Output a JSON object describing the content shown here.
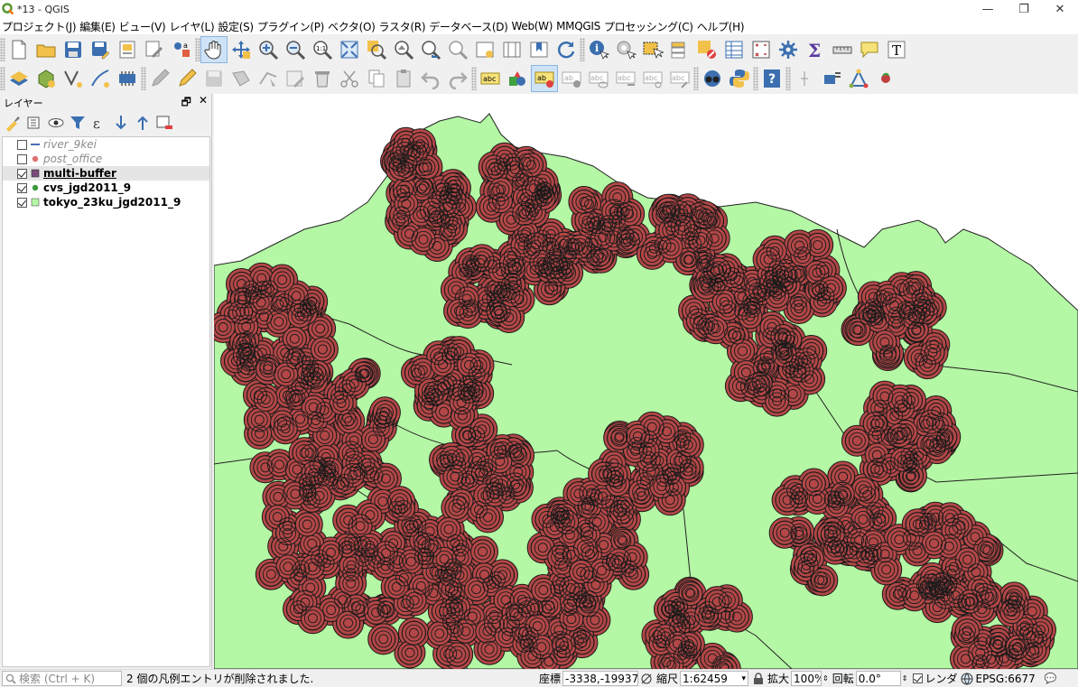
{
  "window": {
    "title": "*13 - QGIS",
    "min": "—",
    "restore": "❐",
    "close": "✕"
  },
  "menubar": [
    "プロジェクト(J)",
    "編集(E)",
    "ビュー(V)",
    "レイヤ(L)",
    "設定(S)",
    "プラグイン(P)",
    "ベクタ(O)",
    "ラスタ(R)",
    "データベース(D)",
    "Web(W)",
    "MMQGIS",
    "プロセッシング(C)",
    "ヘルプ(H)"
  ],
  "layers_panel": {
    "title": "レイヤー",
    "float": "🗗",
    "close": "✕",
    "layers": [
      {
        "name": "river_9kei",
        "checked": false,
        "symbol": "line",
        "color": "#4a6fb5"
      },
      {
        "name": "post_office",
        "checked": false,
        "symbol": "point",
        "color": "#e07070"
      },
      {
        "name": "multi-buffer",
        "checked": true,
        "symbol": "square",
        "color": "#7a4a7a"
      },
      {
        "name": "cvs_jgd2011_9",
        "checked": true,
        "symbol": "point",
        "color": "#3a9a3a"
      },
      {
        "name": "tokyo_23ku_jgd2011_9",
        "checked": true,
        "symbol": "square",
        "color": "#b4f7a4"
      }
    ]
  },
  "map": {
    "fill_land": "#b4f7a4",
    "fill_buffer": "#b34747",
    "stroke": "#1a1a1a",
    "background": "#ffffff"
  },
  "statusbar": {
    "search_placeholder": "検索 (Ctrl + K)",
    "message": "2 個の凡例エントリが削除されました.",
    "coord_label": "座標",
    "coord_value": "-3338,-19937",
    "scale_label": "縮尺",
    "scale_value": "1:62459",
    "magnifier_label": "拡大",
    "magnifier_value": "100%",
    "rotation_label": "回転",
    "rotation_value": "0.0°",
    "render_label": "レンダ",
    "crs": "EPSG:6677"
  }
}
